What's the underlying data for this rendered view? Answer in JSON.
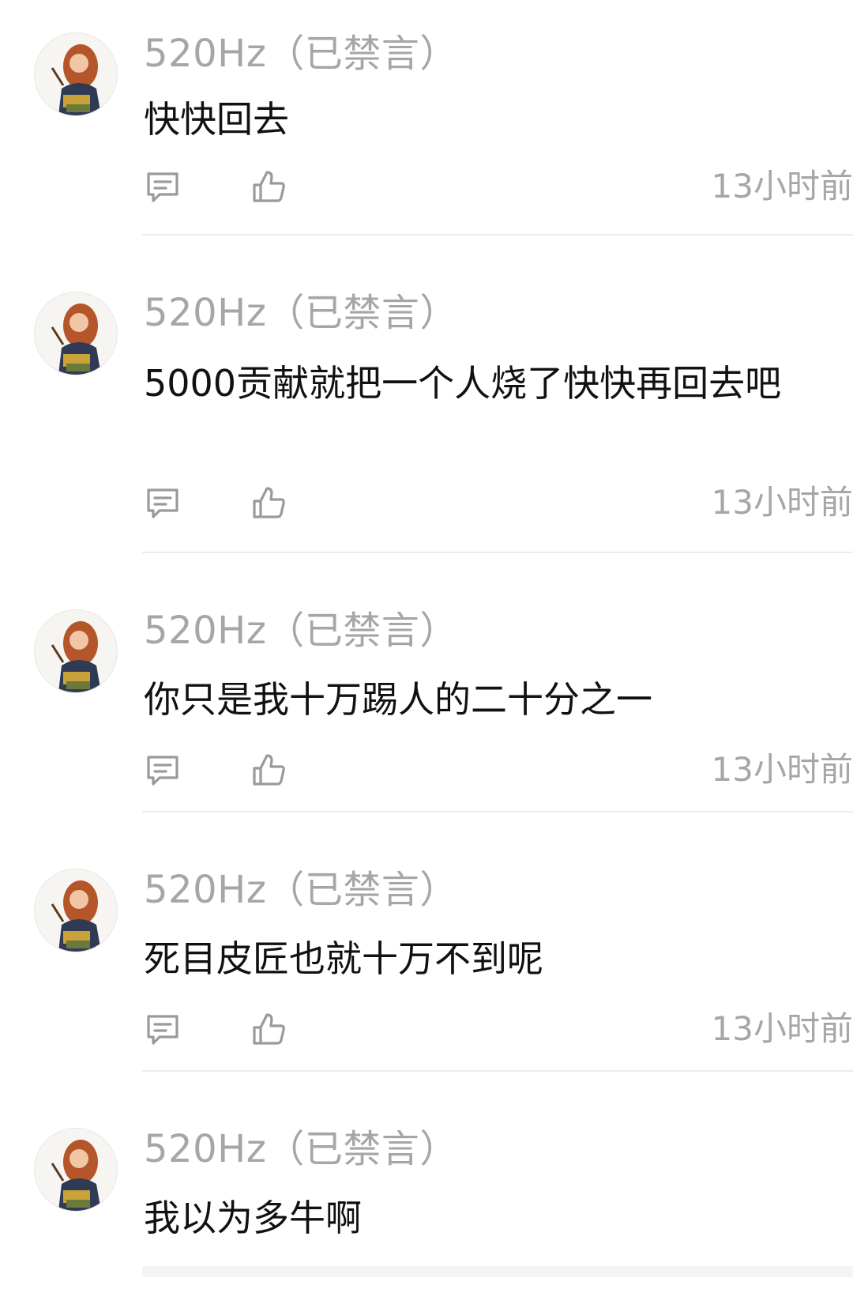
{
  "comments": [
    {
      "user": "520Hz（已禁言）",
      "text": "快快回去",
      "time": "13小时前",
      "avatar_icon": "avatar-icon",
      "reply_icon": "comment-icon",
      "like_icon": "thumbs-up-icon"
    },
    {
      "user": "520Hz（已禁言）",
      "text": "5000贡献就把一个人烧了快快再回去吧",
      "time": "13小时前",
      "avatar_icon": "avatar-icon",
      "reply_icon": "comment-icon",
      "like_icon": "thumbs-up-icon"
    },
    {
      "user": "520Hz（已禁言）",
      "text": "你只是我十万踢人的二十分之一",
      "time": "13小时前",
      "avatar_icon": "avatar-icon",
      "reply_icon": "comment-icon",
      "like_icon": "thumbs-up-icon"
    },
    {
      "user": "520Hz（已禁言）",
      "text": "死目皮匠也就十万不到呢",
      "time": "13小时前",
      "avatar_icon": "avatar-icon",
      "reply_icon": "comment-icon",
      "like_icon": "thumbs-up-icon"
    },
    {
      "user": "520Hz（已禁言）",
      "text": "我以为多牛啊",
      "time": "",
      "avatar_icon": "avatar-icon",
      "reply_icon": "",
      "like_icon": ""
    }
  ],
  "colors": {
    "username": "#a6a6a6",
    "text": "#111111",
    "timestamp": "#a6a6a6",
    "icon": "#9a9a9a",
    "divider": "#ececec"
  }
}
